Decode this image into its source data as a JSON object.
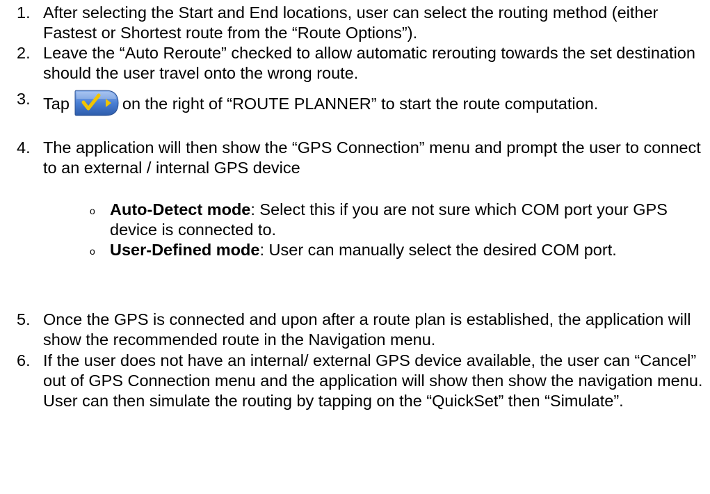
{
  "steps": [
    {
      "number": "1.",
      "text": "After selecting the Start and End locations, user can select the routing method (either Fastest or Shortest route from the “Route Options”)."
    },
    {
      "number": "2.",
      "text": "Leave the “Auto Reroute” checked to allow automatic rerouting towards the set destination should the user travel onto the wrong route."
    },
    {
      "number": "3.",
      "text_before_icon": "Tap",
      "icon": "checkmark-arrow-button-icon",
      "text_after_icon": "on the right of “ROUTE PLANNER” to start the route computation."
    },
    {
      "number": "4.",
      "text": "The application will then show the “GPS Connection” menu and prompt the user to connect to an external / internal GPS device"
    },
    {
      "number": "5.",
      "text": "Once the GPS is connected and upon after a route plan is established, the application will show the recommended route in the Navigation menu."
    },
    {
      "number": "6.",
      "text": "If the user does not have an internal/ external GPS device available, the user can “Cancel” out of GPS Connection menu and the application will show then show the navigation menu.  User can then simulate the routing by tapping on the “QuickSet” then “Simulate”."
    }
  ],
  "modes": [
    {
      "bullet": "o",
      "name": "Auto-Detect mode",
      "description": ": Select this if you are not sure which COM port your GPS device is connected to."
    },
    {
      "bullet": "o",
      "name": "User-Defined mode",
      "description": ": User can manually select the desired COM port."
    }
  ],
  "colors": {
    "text": "#000000",
    "icon_blue": "#3f6fc4",
    "icon_check": "#f2c400"
  }
}
